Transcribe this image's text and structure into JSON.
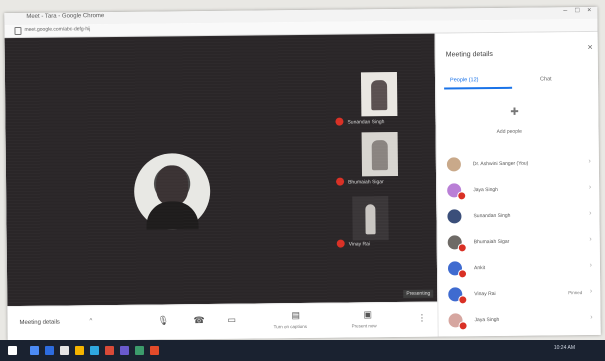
{
  "browser": {
    "tab_title": "Meet - Tara - Google Chrome",
    "url": "meet.google.com/abc-defg-hij",
    "window_controls": [
      "–",
      "□",
      "×"
    ]
  },
  "stage": {
    "presenting_chip": "Presenting",
    "tiles": [
      {
        "label": "Sunandan Singh",
        "mic_off": true
      },
      {
        "label": "Bhumaiah Sigar",
        "mic_off": true
      },
      {
        "label": "Vinay Rai",
        "mic_off": true
      }
    ]
  },
  "controls": {
    "meeting_details": "Meeting details",
    "caret": "^",
    "mic_icon": "microphone-icon",
    "hangup_icon": "phone-hangup-icon",
    "camera_icon": "camera-icon",
    "captions_label": "Turn on captions",
    "present_label": "Present now",
    "more_icon": "more-vert-icon"
  },
  "panel": {
    "heading": "Meeting details",
    "close": "×",
    "tabs": [
      {
        "label": "People (12)",
        "active": true
      },
      {
        "label": "Chat",
        "active": false
      }
    ],
    "add_label": "Add people",
    "people": [
      {
        "name": "Dr. Ashwini Sanger (You)",
        "color": "#c9a98a",
        "muted": false,
        "tag": ""
      },
      {
        "name": "Jaya Singh",
        "color": "#b97fd6",
        "muted": true,
        "tag": ""
      },
      {
        "name": "Sunandan Singh",
        "color": "#3b4f7a",
        "muted": false,
        "tag": ""
      },
      {
        "name": "Bhumaiah Sigar",
        "color": "#6e6a66",
        "muted": true,
        "tag": ""
      },
      {
        "name": "Ankit",
        "color": "#3f6bd0",
        "muted": true,
        "tag": ""
      },
      {
        "name": "Vinay Rai",
        "color": "#3f6bd0",
        "muted": true,
        "tag": "Pinned"
      },
      {
        "name": "Jaya Singh",
        "color": "#d6a6a0",
        "muted": true,
        "tag": ""
      }
    ]
  },
  "taskbar": {
    "clock": "10:24 AM",
    "colors": [
      "#4c8bf5",
      "#2d6cdf",
      "#e5e5e5",
      "#f5b400",
      "#2fa8e0",
      "#d94a38",
      "#6a5acd",
      "#3c9b6b",
      "#e34b2a"
    ]
  }
}
